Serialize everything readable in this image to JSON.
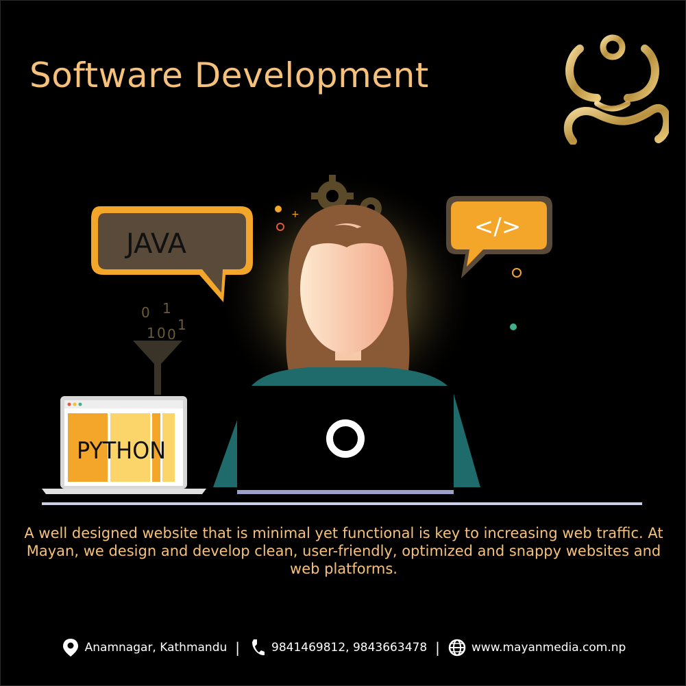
{
  "title": "Software Development",
  "bubbles": {
    "java": "JAVA",
    "code": "</>",
    "python": "PYTHON",
    "binary": [
      "0",
      "1",
      "1",
      "0",
      "0",
      "1"
    ]
  },
  "description": "A well designed website that is minimal yet functional is key to increasing web traffic. At Mayan, we design and develop  clean, user-friendly, optimized and snappy websites and web platforms.",
  "footer": {
    "address": "Anamnagar, Kathmandu",
    "phone": "9841469812, 9843663478",
    "website": "www.mayanmedia.com.np",
    "separator": "|"
  },
  "icons": {
    "logo": "mayan-logo",
    "address": "location-pin-icon",
    "phone": "phone-icon",
    "website": "globe-icon"
  },
  "colors": {
    "background": "#000000",
    "accent": "#f6c27b",
    "bubble_orange": "#f4a62a",
    "gold": "#c9a24a",
    "teal": "#1f6a6a"
  }
}
